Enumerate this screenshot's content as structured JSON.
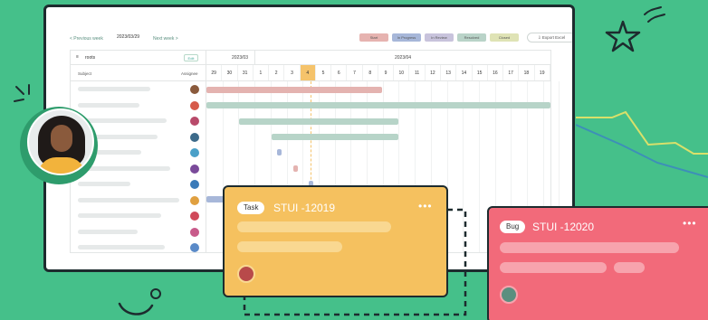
{
  "toolbar": {
    "prev_week": "< Previous week",
    "date": "2023/03/29",
    "next_week": "Next week >",
    "legend": [
      {
        "label": "Start",
        "color": "#e6b3b0"
      },
      {
        "label": "In Progress",
        "color": "#a7b7d9"
      },
      {
        "label": "In Review",
        "color": "#c8c3dc"
      },
      {
        "label": "Resolved",
        "color": "#b9d3c8"
      },
      {
        "label": "Closed",
        "color": "#dfe3b5"
      }
    ],
    "export_label": "Export Excel"
  },
  "left_header": {
    "filter_text": "roots",
    "edit_label": "Edit",
    "subject_label": "Subject",
    "assignee_label": "Assignee"
  },
  "months": {
    "first": "2023/03",
    "second": "2023/04"
  },
  "days": [
    "29",
    "30",
    "31",
    "1",
    "2",
    "3",
    "4",
    "5",
    "6",
    "7",
    "8",
    "9",
    "10",
    "11",
    "12",
    "13",
    "14",
    "15",
    "16",
    "17",
    "18",
    "19"
  ],
  "today_index": 6,
  "rows": [
    {
      "avatar_color": "#8a5a3c"
    },
    {
      "avatar_color": "#d65a4a"
    },
    {
      "avatar_color": "#b84a6a"
    },
    {
      "avatar_color": "#3c6a8a"
    },
    {
      "avatar_color": "#4aa0c8"
    },
    {
      "avatar_color": "#7a4a9a"
    },
    {
      "avatar_color": "#3a7ab8"
    },
    {
      "avatar_color": "#e0a040"
    },
    {
      "avatar_color": "#d04a5a"
    },
    {
      "avatar_color": "#c85a8a"
    },
    {
      "avatar_color": "#5a8ac8"
    }
  ],
  "card_task": {
    "type_label": "Task",
    "ticket": "STUI -12019",
    "more": "•••",
    "color": "#f5c15f"
  },
  "card_bug": {
    "type_label": "Bug",
    "ticket": "STUI -12020",
    "more": "•••",
    "color": "#f26a7a"
  }
}
